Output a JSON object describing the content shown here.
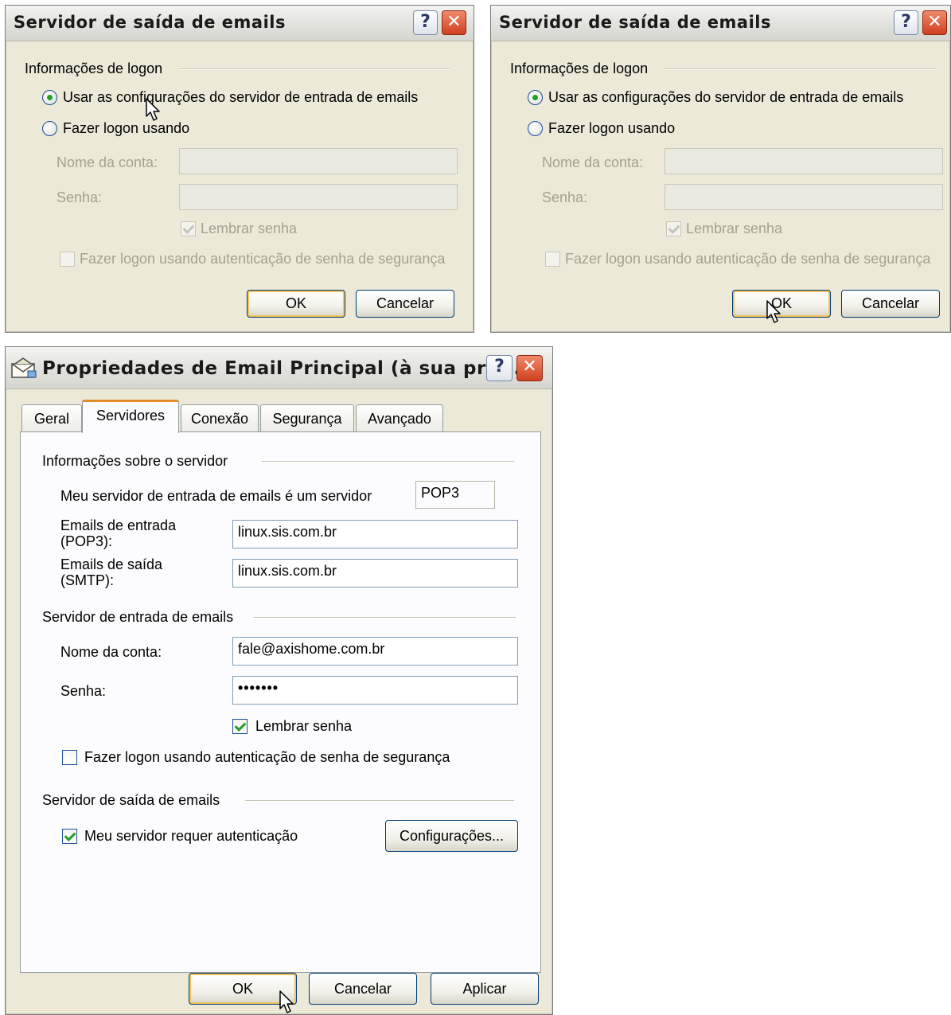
{
  "dialog1": {
    "title": "Servidor de saída de emails",
    "help": "?",
    "close": "✕",
    "section": "Informações de logon",
    "radio_use_incoming": "Usar as configurações do servidor de entrada de emails",
    "radio_logon_using": "Fazer logon usando",
    "account_label": "Nome da conta:",
    "password_label": "Senha:",
    "account_value": "",
    "password_value": "",
    "remember_password": "Lembrar senha",
    "spa": "Fazer logon usando autenticação de senha de segurança",
    "ok": "OK",
    "cancel": "Cancelar"
  },
  "dialog2": {
    "title": "Servidor de saída de emails",
    "help": "?",
    "close": "✕",
    "section": "Informações de logon",
    "radio_use_incoming": "Usar as configurações do servidor de entrada de emails",
    "radio_logon_using": "Fazer logon usando",
    "account_label": "Nome da conta:",
    "password_label": "Senha:",
    "account_value": "",
    "password_value": "",
    "remember_password": "Lembrar senha",
    "spa": "Fazer logon usando autenticação de senha de segurança",
    "ok": "OK",
    "cancel": "Cancelar"
  },
  "props": {
    "title": "Propriedades de Email Principal  (à sua pref...",
    "help": "?",
    "close": "✕",
    "icon": "envelope-icon",
    "tabs": [
      "Geral",
      "Servidores",
      "Conexão",
      "Segurança",
      "Avançado"
    ],
    "active_tab": "Servidores",
    "server_info_section": "Informações sobre o servidor",
    "incoming_type_label": "Meu servidor de entrada de emails é um  servidor",
    "incoming_type_value": "POP3",
    "incoming_label_1": "Emails de entrada",
    "incoming_label_2": "(POP3):",
    "incoming_value": "linux.sis.com.br",
    "outgoing_label_1": "Emails de saída",
    "outgoing_label_2": "(SMTP):",
    "outgoing_value": "linux.sis.com.br",
    "incoming_server_section": "Servidor de entrada de emails",
    "account_label": "Nome da conta:",
    "account_value": "fale@axishome.com.br",
    "password_label": "Senha:",
    "password_value": "•••••••",
    "remember_password": "Lembrar senha",
    "spa": "Fazer logon usando autenticação de senha de segurança",
    "outgoing_server_section": "Servidor de saída de emails",
    "requires_auth": "Meu servidor requer autenticação",
    "settings_button": "Configurações...",
    "ok": "OK",
    "cancel": "Cancelar",
    "apply": "Aplicar"
  },
  "colors": {
    "dialog_bg": "#ece9d8",
    "check_green": "#21a121",
    "default_button_glow": "#f4c15b",
    "active_tab_accent": "#e68b2c",
    "close_button": "#d04020"
  }
}
